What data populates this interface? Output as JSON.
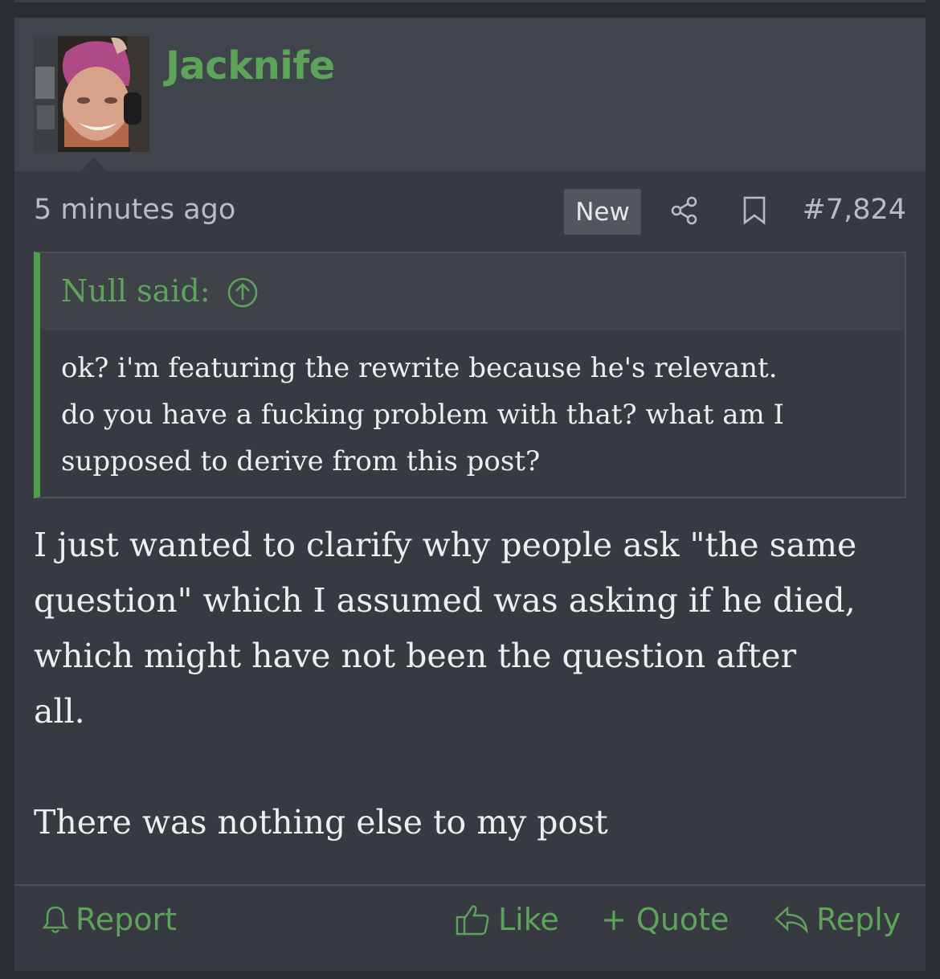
{
  "post": {
    "username": "Jacknife",
    "timestamp": "5 minutes ago",
    "new_badge": "New",
    "post_number": "#7,824",
    "icons": [
      "share-icon",
      "bookmark-icon",
      "arrow-up-circle-icon",
      "bell-icon",
      "thumbs-up-icon",
      "reply-icon"
    ],
    "quote": {
      "author_label": "Null said:",
      "lines": [
        "ok? i'm featuring the rewrite because he's relevant.",
        "do you have a fucking problem with that? what am I",
        "supposed to derive from this post?"
      ]
    },
    "message": {
      "lines": [
        "I just wanted to clarify why people ask \"the same",
        "question\" which I assumed was asking if he died,",
        "which might have not been the question after",
        "all."
      ],
      "closing": "There was nothing else to my post"
    },
    "actions": {
      "report": "Report",
      "like": "Like",
      "quote": "+ Quote",
      "reply": "Reply"
    }
  },
  "colors": {
    "accent_green": "#5ea35a",
    "quote_border": "#4f9e4c",
    "post_background": "#373a41",
    "header_background": "#40444b",
    "text": "#eceef0",
    "muted_text": "#b8bcc3"
  }
}
